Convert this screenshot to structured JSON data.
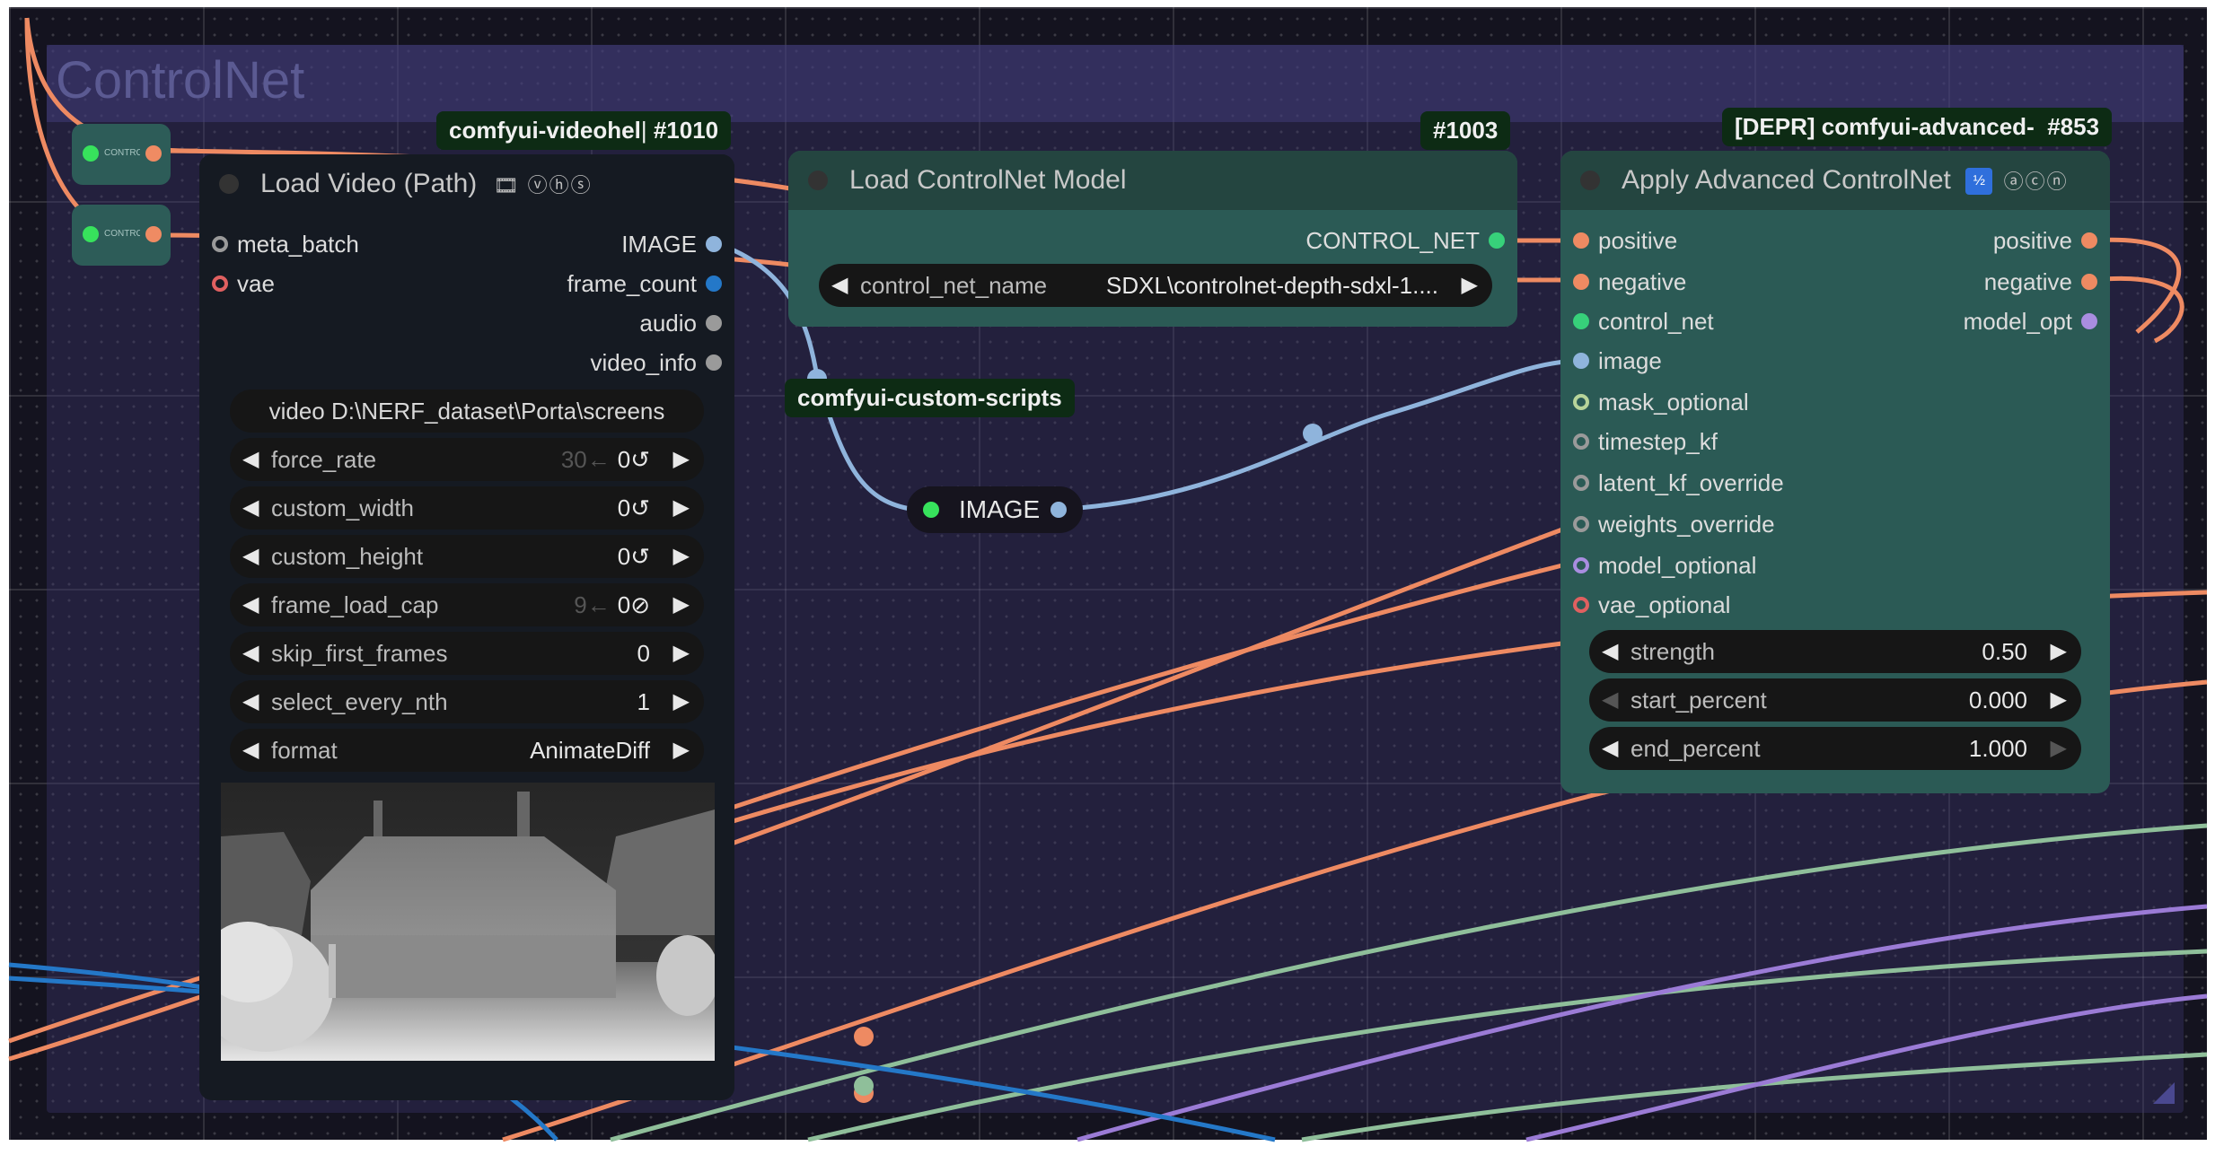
{
  "group": {
    "title": "ControlNet"
  },
  "mini_nodes": [
    {
      "label": "CONTROL"
    },
    {
      "label": "CONTROL"
    }
  ],
  "badges": {
    "video": {
      "source": "comfyui-videohel",
      "id": "#1010"
    },
    "loader": {
      "id": "#1003"
    },
    "advanced": {
      "source": "[DEPR] comfyui-advanced-",
      "id": "#853"
    },
    "scripts": {
      "source": "comfyui-custom-scripts"
    }
  },
  "load_video": {
    "title": "Load Video (Path)",
    "title_icons": "🎞 ⓥⓗⓢ",
    "inputs": [
      "meta_batch",
      "vae"
    ],
    "outputs": [
      "IMAGE",
      "frame_count",
      "audio",
      "video_info"
    ],
    "video_field": "video D:\\NERF_dataset\\Porta\\screens",
    "widgets": [
      {
        "label": "force_rate",
        "extra": "30←",
        "value": "0↺"
      },
      {
        "label": "custom_width",
        "extra": "",
        "value": "0↺"
      },
      {
        "label": "custom_height",
        "extra": "",
        "value": "0↺"
      },
      {
        "label": "frame_load_cap",
        "extra": "9←",
        "value": "0⊘"
      },
      {
        "label": "skip_first_frames",
        "extra": "",
        "value": "0"
      },
      {
        "label": "select_every_nth",
        "extra": "",
        "value": "1"
      },
      {
        "label": "format",
        "extra": "",
        "value": "AnimateDiff"
      }
    ]
  },
  "load_controlnet": {
    "title": "Load ControlNet Model",
    "output": "CONTROL_NET",
    "widget": {
      "label": "control_net_name",
      "value": "SDXL\\controlnet-depth-sdxl-1...."
    }
  },
  "reroute": {
    "label": "IMAGE"
  },
  "apply_advanced": {
    "title": "Apply Advanced ControlNet",
    "title_icons": "ⓐⓒⓝ",
    "inputs": [
      "positive",
      "negative",
      "control_net",
      "image",
      "mask_optional",
      "timestep_kf",
      "latent_kf_override",
      "weights_override",
      "model_optional",
      "vae_optional"
    ],
    "outputs": [
      "positive",
      "negative",
      "model_opt"
    ],
    "widgets": [
      {
        "label": "strength",
        "value": "0.50"
      },
      {
        "label": "start_percent",
        "value": "0.000"
      },
      {
        "label": "end_percent",
        "value": "1.000"
      }
    ]
  },
  "colors": {
    "canvas": "#14131f",
    "node_body_video": "#151a22",
    "node_body_teal": "#2b5a55",
    "node_title_teal": "#244540",
    "wire_orange": "#ee8a62",
    "wire_blue": "#8fb4dc",
    "wire_green": "#8fbf9a",
    "wire_purple": "#9b7bd6",
    "wire_dark_blue": "#2478c8"
  }
}
